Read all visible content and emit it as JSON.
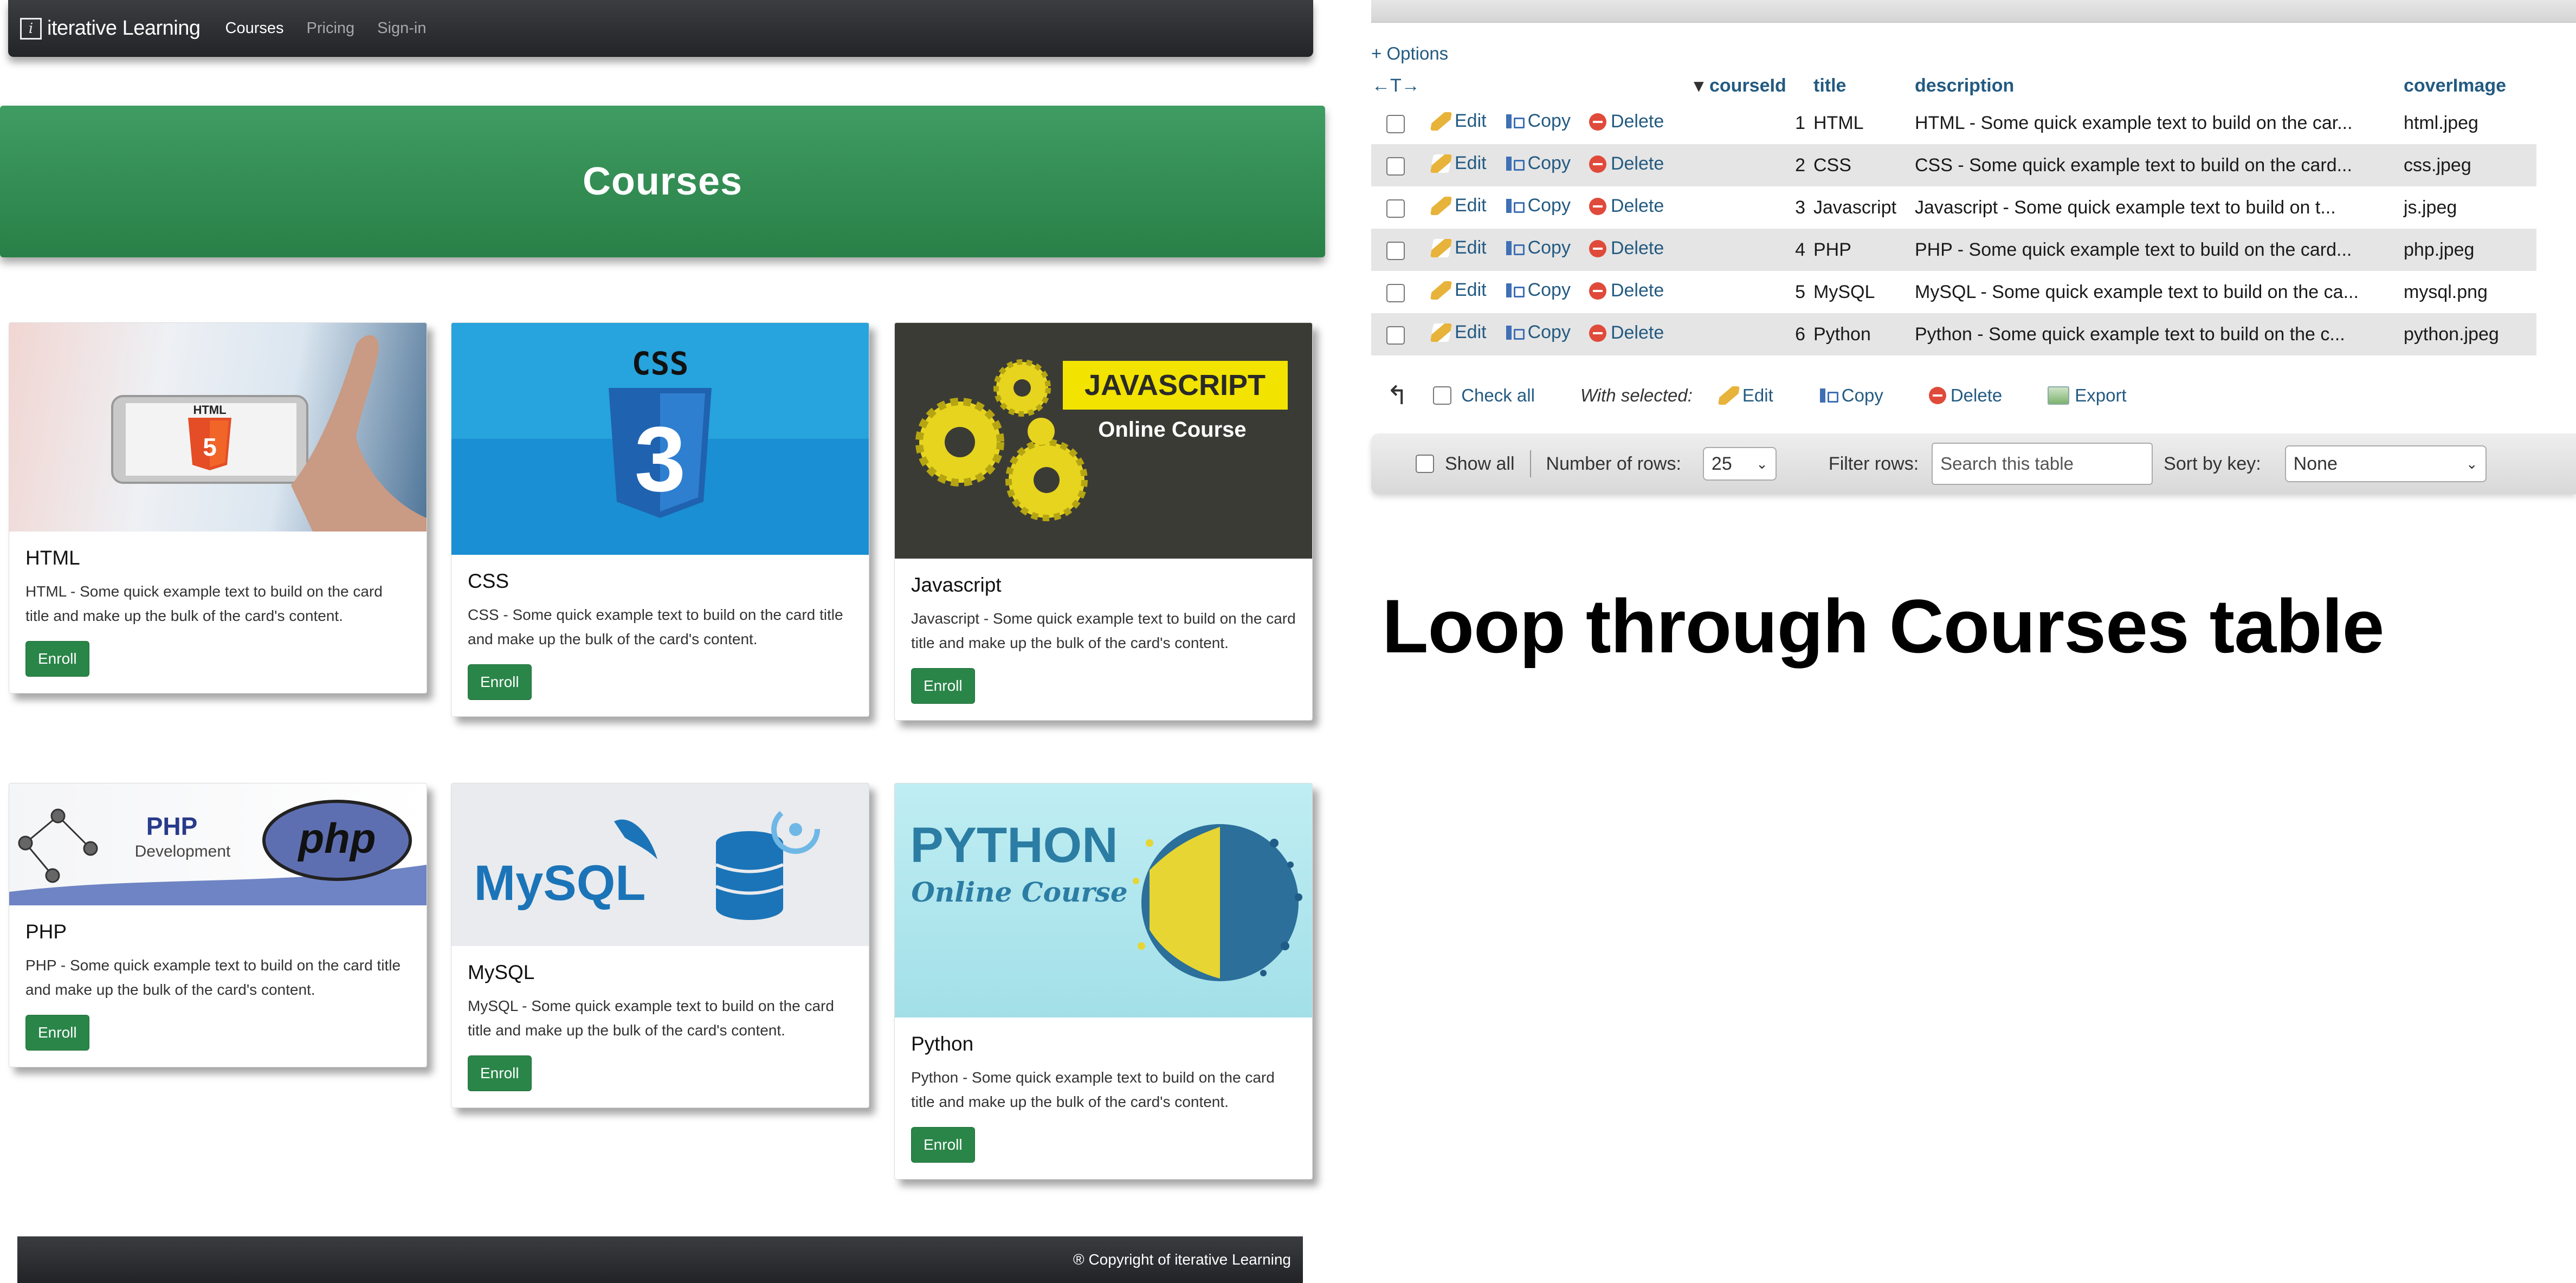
{
  "site": {
    "brand": "iterative Learning",
    "brand_logo_letter": "i",
    "nav": [
      "Courses",
      "Pricing",
      "Sign-in"
    ],
    "hero_title": "Courses",
    "cards": [
      {
        "title": "HTML",
        "text": "HTML - Some quick example text to build on the card title and make up the bulk of the card's content.",
        "button": "Enroll",
        "img_label": "HTML 5"
      },
      {
        "title": "CSS",
        "text": "CSS - Some quick example text to build on the card title and make up the bulk of the card's content.",
        "button": "Enroll",
        "img_label": "CSS 3"
      },
      {
        "title": "Javascript",
        "text": "Javascript - Some quick example text to build on the card title and make up the bulk of the card's content.",
        "button": "Enroll",
        "img_label": "JAVASCRIPT",
        "img_sub": "Online Course"
      },
      {
        "title": "PHP",
        "text": "PHP - Some quick example text to build on the card title and make up the bulk of the card's content.",
        "button": "Enroll",
        "img_label": "PHP",
        "img_sub": "Development",
        "img_logo": "php"
      },
      {
        "title": "MySQL",
        "text": "MySQL - Some quick example text to build on the card title and make up the bulk of the card's content.",
        "button": "Enroll",
        "img_label": "MySQL"
      },
      {
        "title": "Python",
        "text": "Python - Some quick example text to build on the card title and make up the bulk of the card's content.",
        "button": "Enroll",
        "img_label": "PYTHON",
        "img_sub": "Online Course"
      }
    ],
    "footer": "® Copyright of iterative Learning"
  },
  "pma": {
    "options_link": "+ Options",
    "columns": [
      "courseId",
      "title",
      "description",
      "coverImage"
    ],
    "row_actions": {
      "edit": "Edit",
      "copy": "Copy",
      "delete": "Delete"
    },
    "rows": [
      {
        "courseId": "1",
        "title": "HTML",
        "description": "HTML - Some quick example text to build on the car...",
        "coverImage": "html.jpeg"
      },
      {
        "courseId": "2",
        "title": "CSS",
        "description": "CSS - Some quick example text to build on the card...",
        "coverImage": "css.jpeg"
      },
      {
        "courseId": "3",
        "title": "Javascript",
        "description": "Javascript - Some quick example text to build on t...",
        "coverImage": "js.jpeg"
      },
      {
        "courseId": "4",
        "title": "PHP",
        "description": "PHP - Some quick example text to build on the card...",
        "coverImage": "php.jpeg"
      },
      {
        "courseId": "5",
        "title": "MySQL",
        "description": "MySQL - Some quick example text to build on the ca...",
        "coverImage": "mysql.png"
      },
      {
        "courseId": "6",
        "title": "Python",
        "description": "Python - Some quick example text to build on the c...",
        "coverImage": "python.jpeg"
      }
    ],
    "bulk": {
      "check_all": "Check all",
      "with_selected": "With selected:",
      "edit": "Edit",
      "copy": "Copy",
      "delete": "Delete",
      "export": "Export"
    },
    "nav": {
      "show_all": "Show all",
      "rows_label": "Number of rows:",
      "rows_value": "25",
      "filter_label": "Filter rows:",
      "filter_placeholder": "Search this table",
      "sort_label": "Sort by key:",
      "sort_value": "None"
    }
  },
  "headline": "Loop through Courses table"
}
